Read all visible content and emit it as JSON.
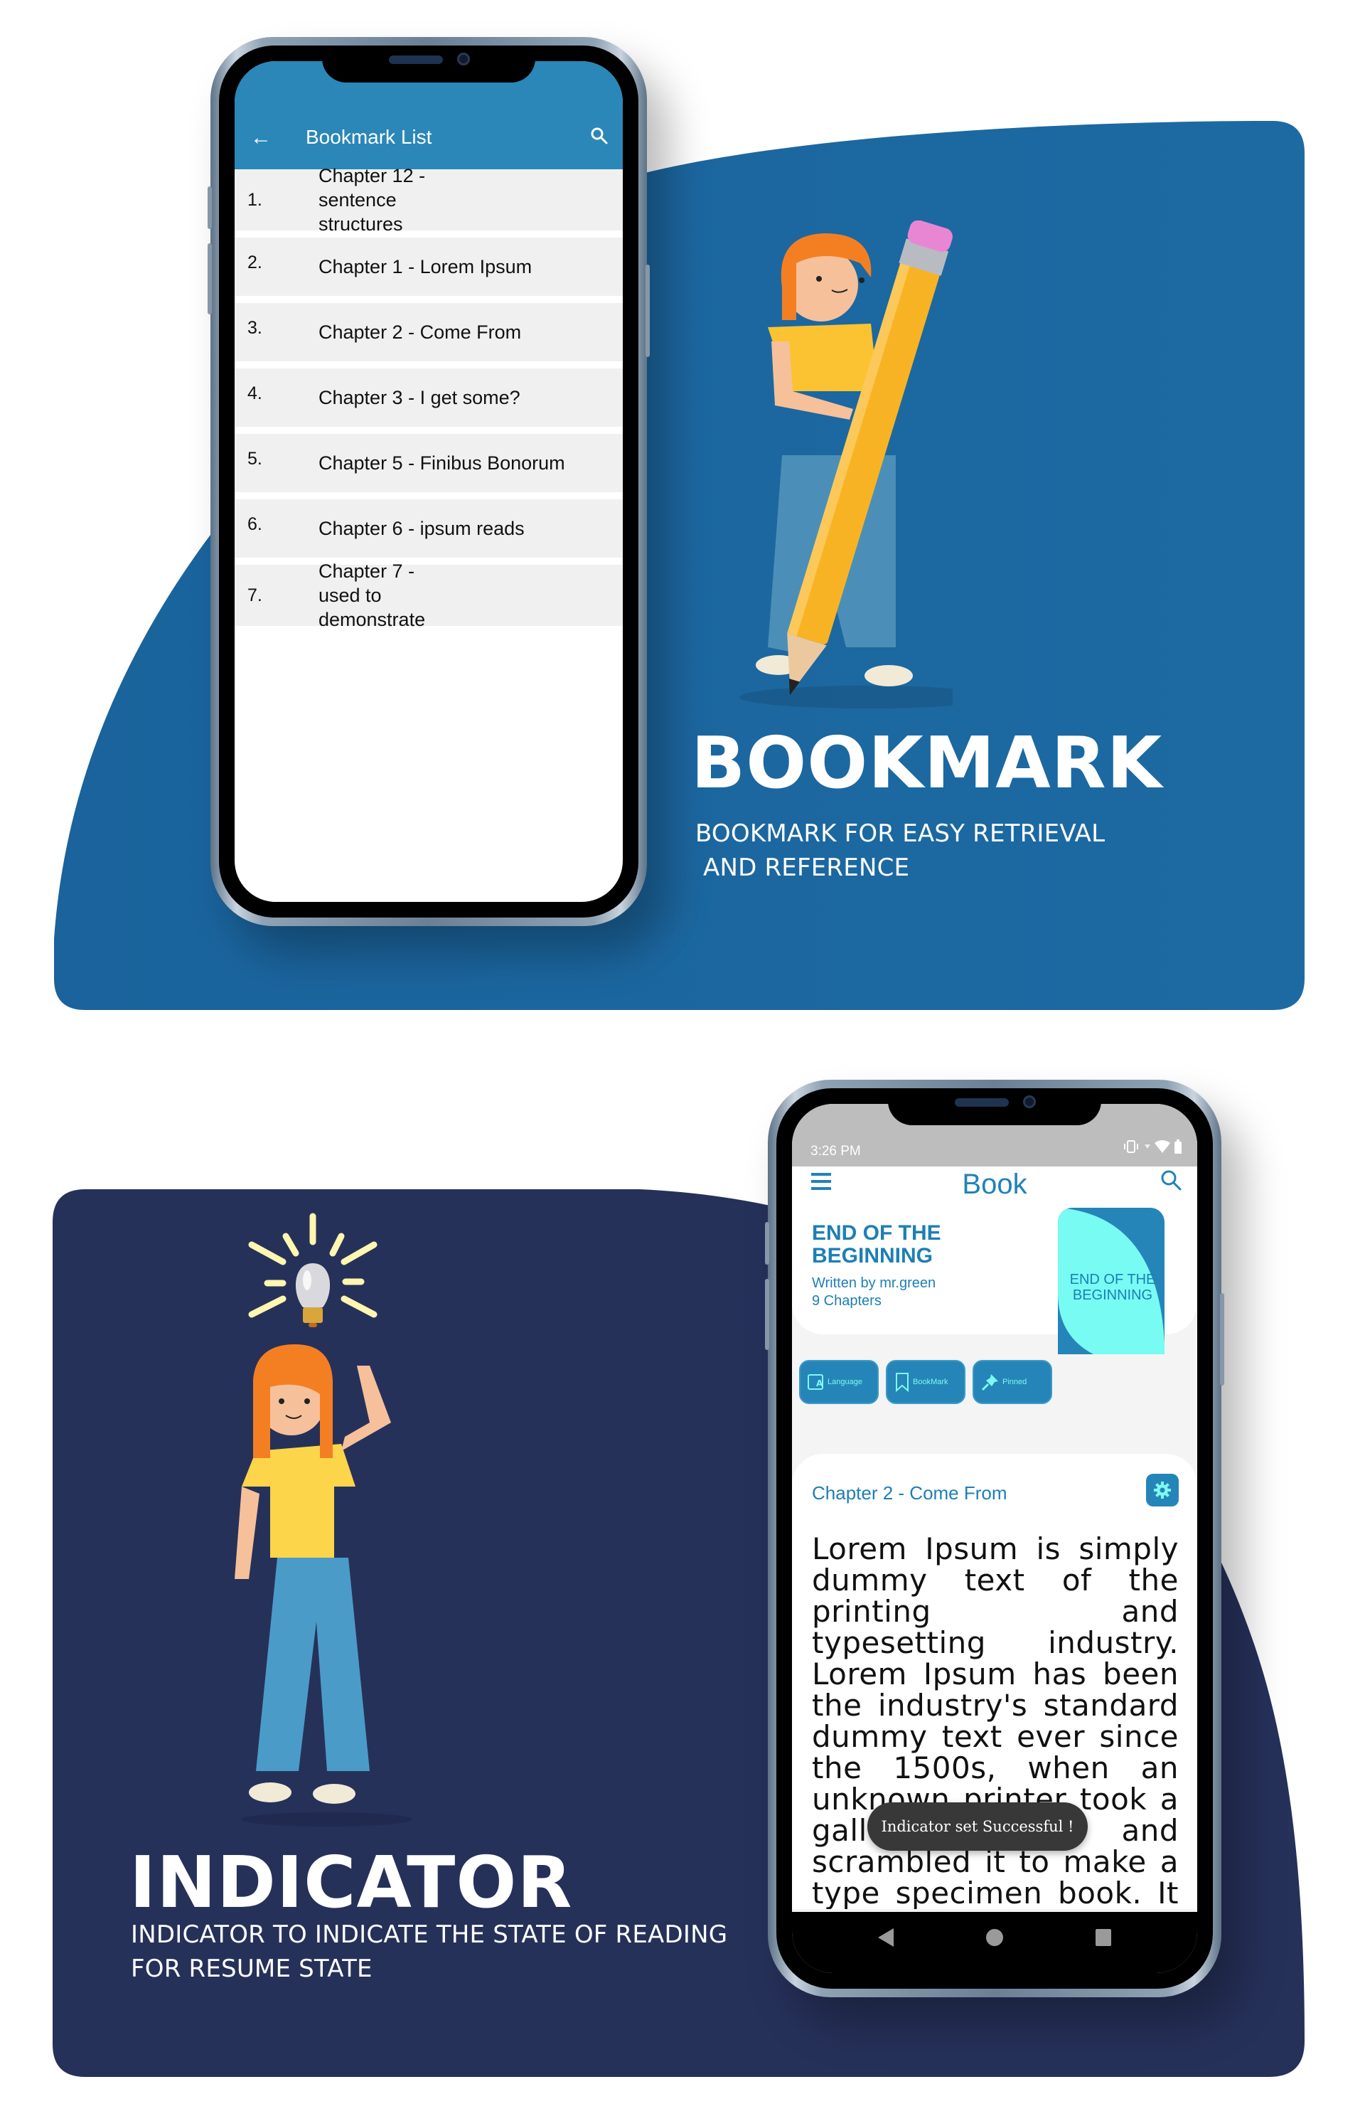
{
  "colors": {
    "bookmark_bg": "#1d6aa3",
    "indicator_bg": "#26315a",
    "appbar": "#2a87b8",
    "accent": "#1d7fb5",
    "cover_light": "#78fbf3",
    "bulb_rays": "#fff6b0"
  },
  "bookmark_section": {
    "heading": "BOOKMARK",
    "subtitle_line1": "BOOKMARK FOR EASY RETRIEVAL",
    "subtitle_line2": " AND REFERENCE",
    "illustration": "girl-holding-pencil",
    "phone": {
      "appbar": {
        "back_icon": "arrow-left-icon",
        "title": "Bookmark List",
        "search_icon": "search-icon"
      },
      "bookmarks": [
        {
          "num": "1.",
          "title": "Chapter 12 - sentence structures"
        },
        {
          "num": "2.",
          "title": "Chapter 1 - Lorem Ipsum"
        },
        {
          "num": "3.",
          "title": "Chapter 2 - Come From"
        },
        {
          "num": "4.",
          "title": "Chapter 3 - I get some?"
        },
        {
          "num": "5.",
          "title": "Chapter 5 - Finibus Bonorum"
        },
        {
          "num": "6.",
          "title": "Chapter 6 - ipsum reads"
        },
        {
          "num": "7.",
          "title": "Chapter 7 - used to demonstrate"
        }
      ]
    }
  },
  "indicator_section": {
    "heading": "INDICATOR",
    "subtitle_line1": "INDICATOR TO INDICATE THE STATE OF READING",
    "subtitle_line2": "FOR RESUME STATE",
    "illustration": "girl-pointing-at-lightbulb",
    "phone": {
      "status_bar": {
        "time": "3:26 PM",
        "icons": [
          "vibrate-icon",
          "wifi-icon",
          "battery-icon"
        ]
      },
      "appbar": {
        "menu_icon": "hamburger-menu-icon",
        "title": "Book",
        "search_icon": "search-icon"
      },
      "book": {
        "title_line1": "END OF THE",
        "title_line2": "BEGINNING",
        "author": "Written by mr.green",
        "chapters": "9 Chapters",
        "cover_line1": "END OF THE",
        "cover_line2": "BEGINNING"
      },
      "actions": [
        {
          "label": "Language",
          "icon": "translate-icon"
        },
        {
          "label": "BookMark",
          "icon": "bookmark-icon"
        },
        {
          "label": "Pinned",
          "icon": "pin-icon"
        }
      ],
      "chapter": {
        "title": "Chapter 2 - Come From",
        "settings_icon": "gear-icon",
        "body": "Lorem Ipsum is simply dummy text of the printing and typesetting industry. Lorem Ipsum has been the industry's standard dummy text ever since the 1500s, when an unknown printer took a galley of type and scrambled it to make a type specimen book. It has survived not only five centuries, but"
      },
      "toast": "Indicator set Successful !",
      "nav": [
        "back-triangle-icon",
        "home-circle-icon",
        "recents-square-icon"
      ]
    }
  }
}
